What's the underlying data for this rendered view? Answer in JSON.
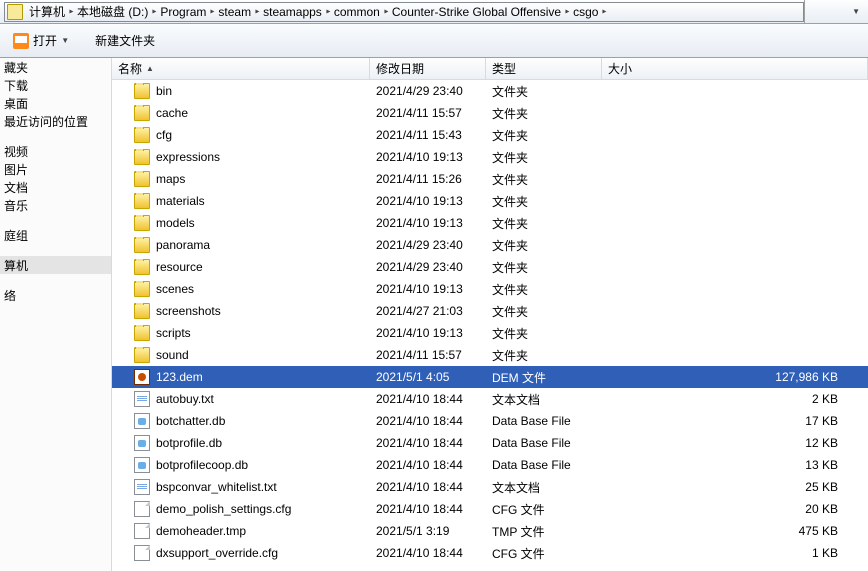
{
  "breadcrumbs": [
    "计算机",
    "本地磁盘 (D:)",
    "Program",
    "steam",
    "steamapps",
    "common",
    "Counter-Strike Global Offensive",
    "csgo"
  ],
  "toolbar": {
    "open_label": "打开",
    "newfolder_label": "新建文件夹"
  },
  "sidebar": {
    "items1": [
      "藏夹",
      "下载",
      "桌面",
      "最近访问的位置"
    ],
    "items2": [
      "视频",
      "图片",
      "文档",
      "音乐"
    ],
    "items3": [
      "庭组"
    ],
    "items4": [
      "算机"
    ],
    "items5": [
      "络"
    ]
  },
  "columns": {
    "name": "名称",
    "date": "修改日期",
    "type": "类型",
    "size": "大小"
  },
  "files": [
    {
      "name": "bin",
      "date": "2021/4/29 23:40",
      "type": "文件夹",
      "size": "",
      "icon": "folder",
      "selected": false
    },
    {
      "name": "cache",
      "date": "2021/4/11 15:57",
      "type": "文件夹",
      "size": "",
      "icon": "folder",
      "selected": false
    },
    {
      "name": "cfg",
      "date": "2021/4/11 15:43",
      "type": "文件夹",
      "size": "",
      "icon": "folder",
      "selected": false
    },
    {
      "name": "expressions",
      "date": "2021/4/10 19:13",
      "type": "文件夹",
      "size": "",
      "icon": "folder",
      "selected": false
    },
    {
      "name": "maps",
      "date": "2021/4/11 15:26",
      "type": "文件夹",
      "size": "",
      "icon": "folder",
      "selected": false
    },
    {
      "name": "materials",
      "date": "2021/4/10 19:13",
      "type": "文件夹",
      "size": "",
      "icon": "folder",
      "selected": false
    },
    {
      "name": "models",
      "date": "2021/4/10 19:13",
      "type": "文件夹",
      "size": "",
      "icon": "folder",
      "selected": false
    },
    {
      "name": "panorama",
      "date": "2021/4/29 23:40",
      "type": "文件夹",
      "size": "",
      "icon": "folder",
      "selected": false
    },
    {
      "name": "resource",
      "date": "2021/4/29 23:40",
      "type": "文件夹",
      "size": "",
      "icon": "folder",
      "selected": false
    },
    {
      "name": "scenes",
      "date": "2021/4/10 19:13",
      "type": "文件夹",
      "size": "",
      "icon": "folder",
      "selected": false
    },
    {
      "name": "screenshots",
      "date": "2021/4/27 21:03",
      "type": "文件夹",
      "size": "",
      "icon": "folder",
      "selected": false
    },
    {
      "name": "scripts",
      "date": "2021/4/10 19:13",
      "type": "文件夹",
      "size": "",
      "icon": "folder",
      "selected": false
    },
    {
      "name": "sound",
      "date": "2021/4/11 15:57",
      "type": "文件夹",
      "size": "",
      "icon": "folder",
      "selected": false
    },
    {
      "name": "123.dem",
      "date": "2021/5/1 4:05",
      "type": "DEM 文件",
      "size": "127,986 KB",
      "icon": "dem",
      "selected": true
    },
    {
      "name": "autobuy.txt",
      "date": "2021/4/10 18:44",
      "type": "文本文档",
      "size": "2 KB",
      "icon": "txt",
      "selected": false
    },
    {
      "name": "botchatter.db",
      "date": "2021/4/10 18:44",
      "type": "Data Base File",
      "size": "17 KB",
      "icon": "db",
      "selected": false
    },
    {
      "name": "botprofile.db",
      "date": "2021/4/10 18:44",
      "type": "Data Base File",
      "size": "12 KB",
      "icon": "db",
      "selected": false
    },
    {
      "name": "botprofilecoop.db",
      "date": "2021/4/10 18:44",
      "type": "Data Base File",
      "size": "13 KB",
      "icon": "db",
      "selected": false
    },
    {
      "name": "bspconvar_whitelist.txt",
      "date": "2021/4/10 18:44",
      "type": "文本文档",
      "size": "25 KB",
      "icon": "txt",
      "selected": false
    },
    {
      "name": "demo_polish_settings.cfg",
      "date": "2021/4/10 18:44",
      "type": "CFG 文件",
      "size": "20 KB",
      "icon": "generic",
      "selected": false
    },
    {
      "name": "demoheader.tmp",
      "date": "2021/5/1 3:19",
      "type": "TMP 文件",
      "size": "475 KB",
      "icon": "generic",
      "selected": false
    },
    {
      "name": "dxsupport_override.cfg",
      "date": "2021/4/10 18:44",
      "type": "CFG 文件",
      "size": "1 KB",
      "icon": "generic",
      "selected": false
    }
  ]
}
